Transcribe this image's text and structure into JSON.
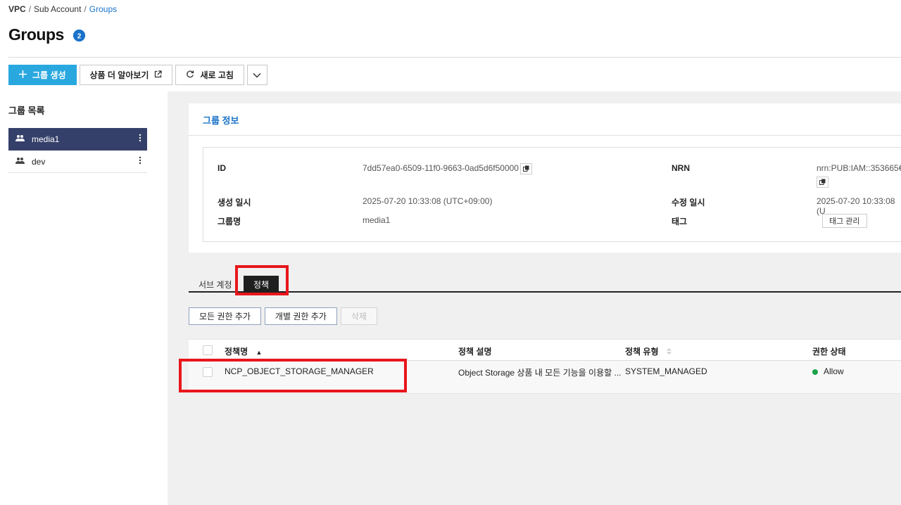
{
  "breadcrumb": {
    "vpc": "VPC",
    "sep": "/",
    "sub_account": "Sub Account",
    "current": "Groups"
  },
  "page": {
    "title": "Groups",
    "help_badge": "?"
  },
  "toolbar": {
    "create_group": "그룹 생성",
    "learn_more": "상품 더 알아보기",
    "refresh": "새로 고침"
  },
  "group_list": {
    "title": "그룹 목록",
    "items": [
      {
        "name": "media1",
        "active": true
      },
      {
        "name": "dev",
        "active": false
      }
    ]
  },
  "group_info": {
    "title": "그룹 정보",
    "id_label": "ID",
    "id_value": "7dd57ea0-6509-11f0-9663-0ad5d6f50000",
    "nrn_label": "NRN",
    "nrn_value": "nrn:PUB:IAM::353665€",
    "created_label": "생성 일시",
    "created_value": "2025-07-20 10:33:08 (UTC+09:00)",
    "modified_label": "수정 일시",
    "modified_value": "2025-07-20 10:33:08 (U",
    "group_name_label": "그룹명",
    "group_name_value": "media1",
    "tag_label": "태그",
    "tag_button": "태그 관리"
  },
  "tabs": {
    "sub_account": "서브 계정",
    "policy": "정책"
  },
  "policy_actions": {
    "add_all": "모든 권한 추가",
    "add_individual": "개별 권한 추가",
    "delete": "삭제"
  },
  "policy_table": {
    "headers": {
      "name": "정책명",
      "name_sort": "▲",
      "description": "정책 설명",
      "type": "정책 유형",
      "status": "권한 상태"
    },
    "rows": [
      {
        "name": "NCP_OBJECT_STORAGE_MANAGER",
        "description": "Object Storage 상품 내 모든 기능을 이용할 ...",
        "type": "SYSTEM_MANAGED",
        "status": "Allow"
      }
    ]
  },
  "colors": {
    "accent": "#1a73c9",
    "primary_button": "#29a8e0",
    "active_group": "#35406a",
    "highlight": "#e8161b",
    "status_allow": "#1ca34a"
  }
}
